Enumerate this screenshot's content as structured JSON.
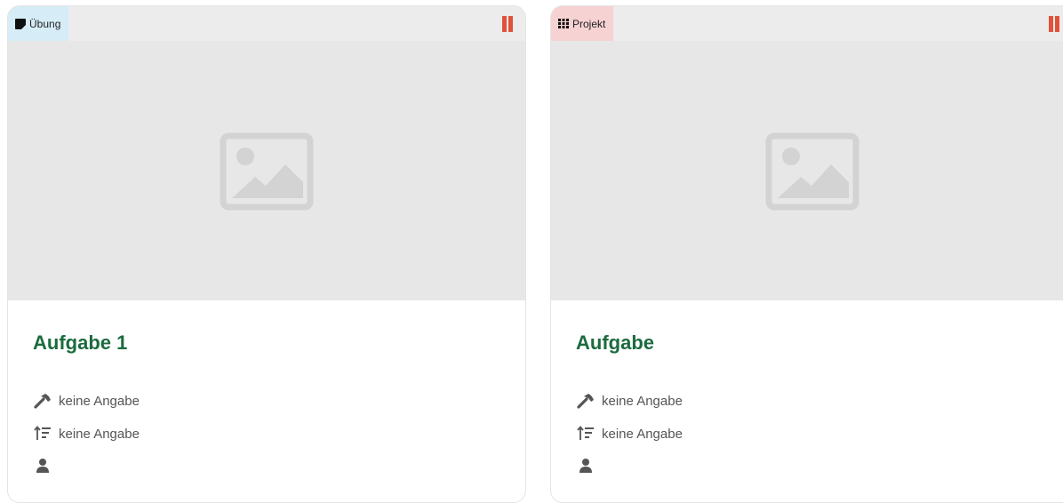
{
  "cards": [
    {
      "type_label": "Übung",
      "type_icon": "note-icon",
      "badge_color": "#d6edf7",
      "title": "Aufgabe 1",
      "difficulty": "keine Angabe",
      "level": "keine Angabe",
      "person": ""
    },
    {
      "type_label": "Projekt",
      "type_icon": "grid-icon",
      "badge_color": "#f6d2d2",
      "title": "Aufgabe",
      "difficulty": "keine Angabe",
      "level": "keine Angabe",
      "person": ""
    }
  ],
  "colors": {
    "title": "#1b6b3e",
    "pause": "#e0533a",
    "meta_text": "#555555",
    "placeholder": "#d3d3d3"
  },
  "icons": {
    "status": "pause-icon",
    "image": "image-placeholder-icon",
    "difficulty": "hammer-icon",
    "level": "sort-amount-icon",
    "person": "user-icon"
  }
}
